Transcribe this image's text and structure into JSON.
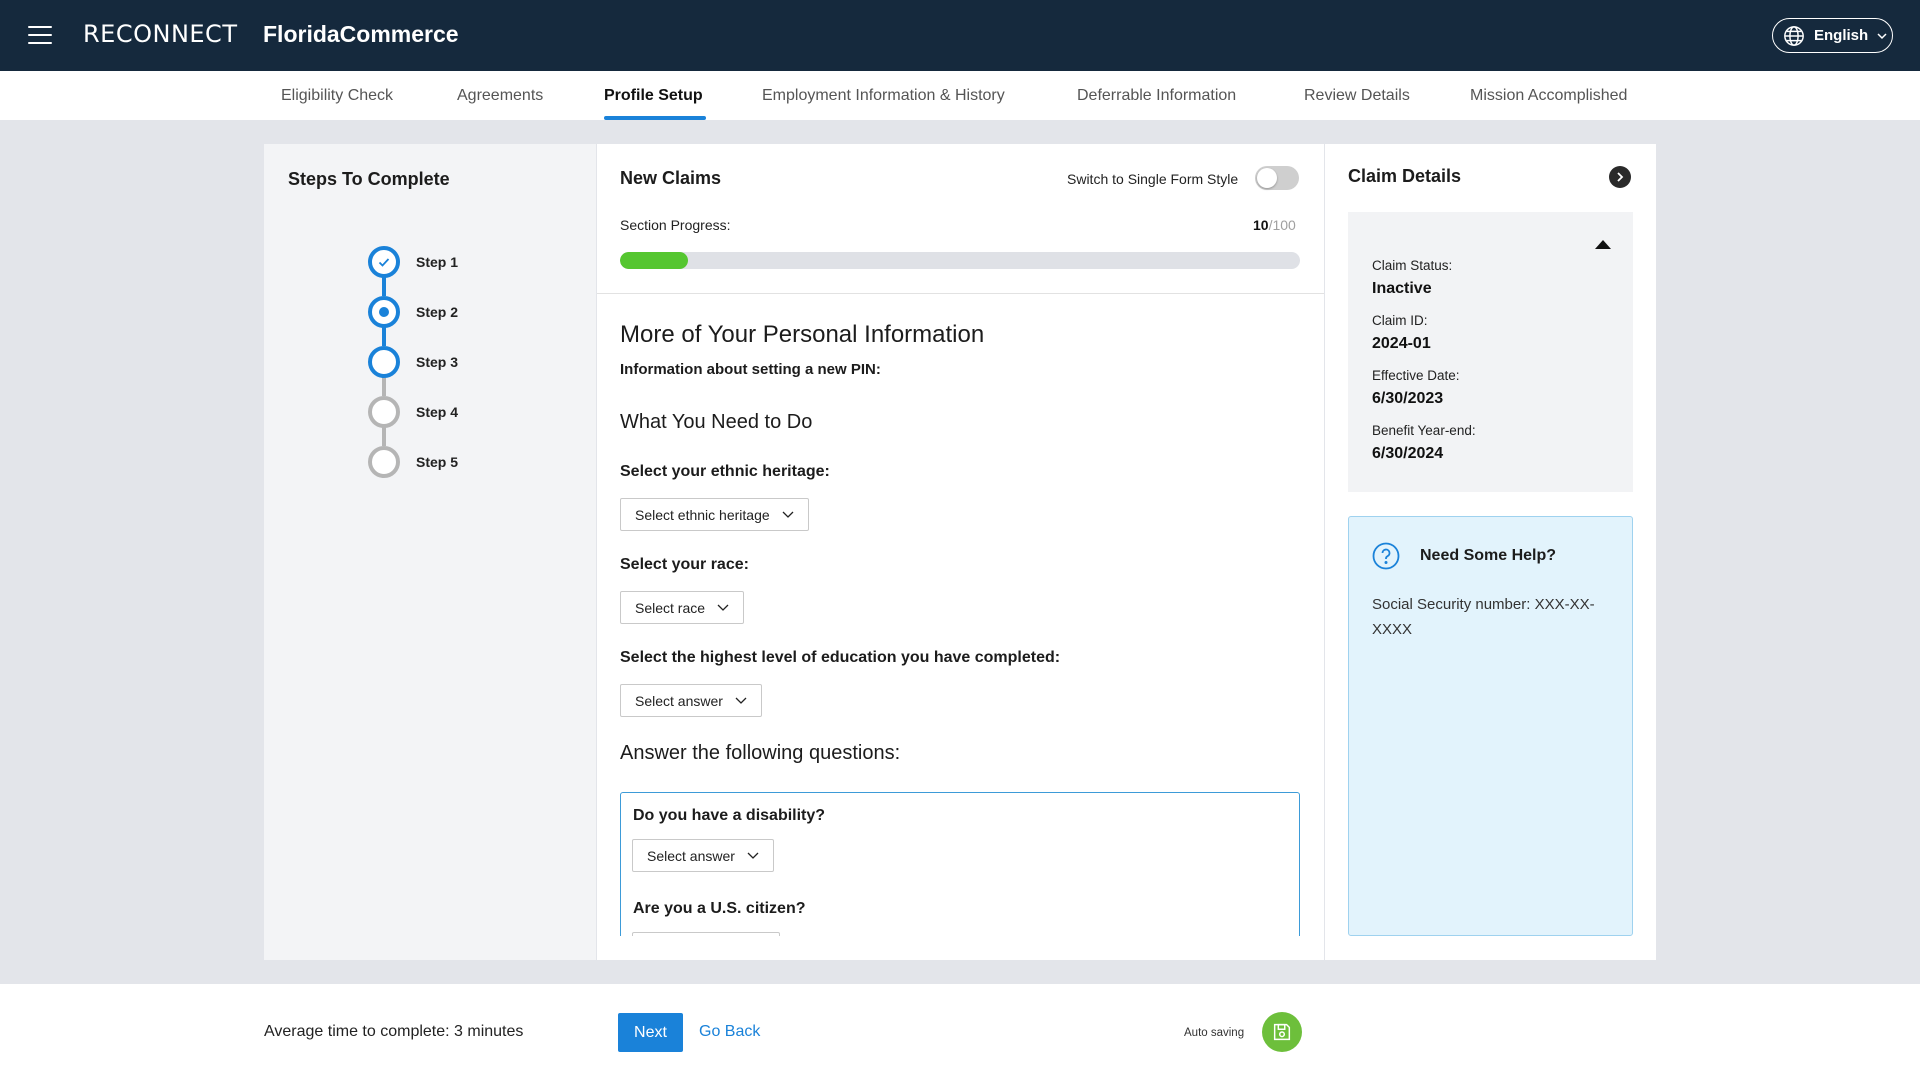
{
  "header": {
    "logo": "RECONNECT",
    "brand": "FloridaCommerce",
    "language": "English"
  },
  "tabs": [
    {
      "label": "Eligibility Check"
    },
    {
      "label": "Agreements"
    },
    {
      "label": "Profile Setup",
      "active": true
    },
    {
      "label": "Employment Information & History"
    },
    {
      "label": "Deferrable Information"
    },
    {
      "label": "Review Details"
    },
    {
      "label": "Mission Accomplished"
    }
  ],
  "steps_panel": {
    "title": "Steps To Complete",
    "steps": [
      {
        "label": "Step 1",
        "state": "completed"
      },
      {
        "label": "Step 2",
        "state": "current"
      },
      {
        "label": "Step 3",
        "state": "active"
      },
      {
        "label": "Step 4",
        "state": "pending"
      },
      {
        "label": "Step 5",
        "state": "pending"
      }
    ]
  },
  "form": {
    "title": "New Claims",
    "switch_label": "Switch to Single Form Style",
    "switch_on": false,
    "progress_label": "Section Progress:",
    "progress_value": "10",
    "progress_max": "/100",
    "progress_fraction": 0.1,
    "section_title": "More of Your Personal Information",
    "pin_info": "Information about setting a new PIN:",
    "todo_title": "What You Need to Do",
    "ethnic_label": "Select your ethnic heritage:",
    "ethnic_placeholder": "Select ethnic heritage",
    "race_label": "Select your race:",
    "race_placeholder": "Select race",
    "education_label": "Select the highest level of education you have completed:",
    "education_placeholder": "Select answer",
    "questions_title": "Answer the following questions:",
    "disability_label": "Do you have a disability?",
    "disability_placeholder": "Select answer",
    "citizen_label": "Are you a U.S. citizen?"
  },
  "claim_details": {
    "title": "Claim Details",
    "status_label": "Claim Status:",
    "status_value": "Inactive",
    "id_label": "Claim ID:",
    "id_value": "2024-01",
    "effective_label": "Effective Date:",
    "effective_value": "6/30/2023",
    "benefit_label": "Benefit Year-end:",
    "benefit_value": "6/30/2024"
  },
  "help": {
    "title": "Need Some Help?",
    "text": "Social Security number: XXX-XX-XXXX"
  },
  "footer": {
    "avg_time": "Average time to complete: 3 minutes",
    "next": "Next",
    "go_back": "Go Back",
    "auto_saving": "Auto saving"
  },
  "colors": {
    "topbar": "#15293d",
    "accent": "#1a82d9",
    "progress": "#55c630",
    "autosave": "#6dbf3b",
    "help_bg": "#e2f3fc"
  }
}
